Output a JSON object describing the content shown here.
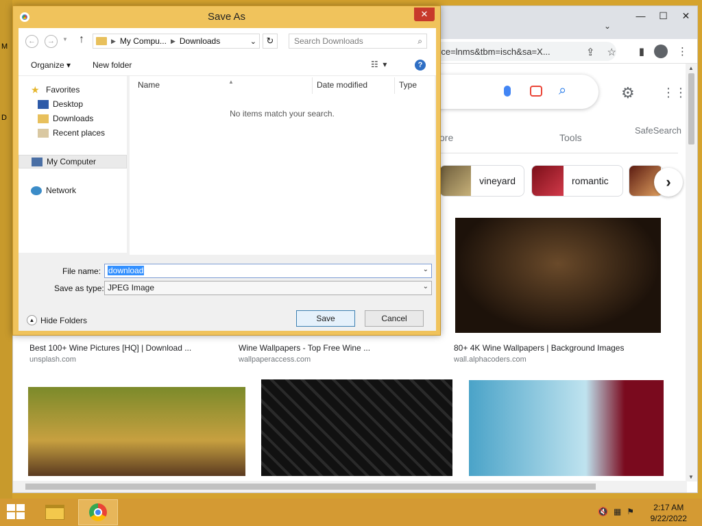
{
  "dialog": {
    "title": "Save As",
    "close_glyph": "✕",
    "breadcrumb": [
      "My Compu...",
      "Downloads"
    ],
    "search_placeholder": "Search Downloads",
    "organize_label": "Organize",
    "new_folder_label": "New folder",
    "nav": {
      "favorites": "Favorites",
      "desktop": "Desktop",
      "downloads": "Downloads",
      "recent": "Recent places",
      "computer": "My Computer",
      "network": "Network"
    },
    "columns": {
      "name": "Name",
      "date_modified": "Date modified",
      "type": "Type"
    },
    "empty_message": "No items match your search.",
    "file_name_label": "File name:",
    "file_name_value": "download",
    "save_type_label": "Save as type:",
    "save_type_value": "JPEG Image",
    "hide_folders_label": "Hide Folders",
    "save_label": "Save",
    "cancel_label": "Cancel"
  },
  "browser": {
    "url_fragment": "rce=lnms&tbm=isch&sa=X...",
    "nav_more": "ore",
    "nav_tools": "Tools",
    "nav_safesearch": "SafeSearch",
    "chips": [
      {
        "label": "vineyard"
      },
      {
        "label": "romantic"
      }
    ],
    "results": [
      {
        "caption": "Best 100+ Wine Pictures [HQ] | Download ...",
        "source": "unsplash.com"
      },
      {
        "caption": "Wine Wallpapers - Top Free Wine ...",
        "source": "wallpaperaccess.com"
      },
      {
        "caption": "80+ 4K Wine Wallpapers | Background Images",
        "source": "wall.alphacoders.com"
      }
    ]
  },
  "taskbar": {
    "time": "2:17 AM",
    "date": "9/22/2022"
  },
  "colors": {
    "desktop": "#d5a32e",
    "dialog_frame": "#f0c35c",
    "close_red": "#c7392b",
    "google_blue": "#1a73e8"
  }
}
